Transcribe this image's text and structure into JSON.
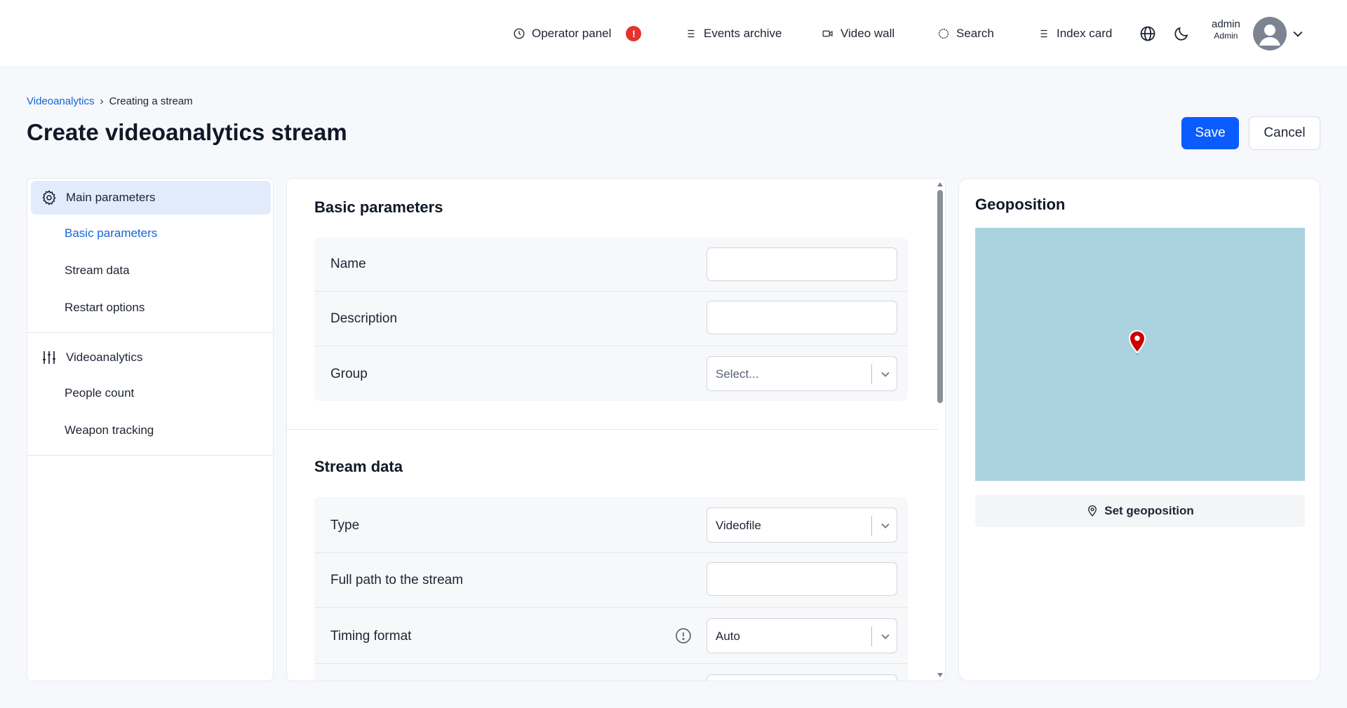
{
  "header": {
    "nav": {
      "operator_panel": "Operator panel",
      "operator_alert": "!",
      "events_archive": "Events archive",
      "video_wall": "Video wall",
      "search": "Search",
      "index_card": "Index card"
    },
    "user": {
      "name": "admin",
      "role": "Admin"
    }
  },
  "breadcrumb": {
    "parent": "Videoanalytics",
    "separator": "›",
    "current": "Creating a stream"
  },
  "page": {
    "title": "Create videoanalytics stream",
    "save_label": "Save",
    "cancel_label": "Cancel"
  },
  "sidebar": {
    "groups": [
      {
        "label": "Main parameters",
        "icon": "gear-icon",
        "items": [
          "Basic parameters",
          "Stream data",
          "Restart options"
        ]
      },
      {
        "label": "Videoanalytics",
        "icon": "sliders-icon",
        "items": [
          "People count",
          "Weapon tracking"
        ]
      }
    ]
  },
  "form": {
    "basic": {
      "title": "Basic parameters",
      "name_label": "Name",
      "name_value": "",
      "description_label": "Description",
      "description_value": "",
      "group_label": "Group",
      "group_placeholder": "Select..."
    },
    "stream": {
      "title": "Stream data",
      "type_label": "Type",
      "type_value": "Videofile",
      "path_label": "Full path to the stream",
      "path_value": "",
      "timing_label": "Timing format",
      "timing_value": "Auto"
    }
  },
  "geo": {
    "title": "Geoposition",
    "button_label": "Set geoposition",
    "map_color": "#aad3df",
    "marker_color": "#cc0000"
  },
  "colors": {
    "accent": "#0b5cff",
    "link": "#1565d8",
    "alert": "#e5322d",
    "active_menu_bg": "#e1ebfb"
  }
}
